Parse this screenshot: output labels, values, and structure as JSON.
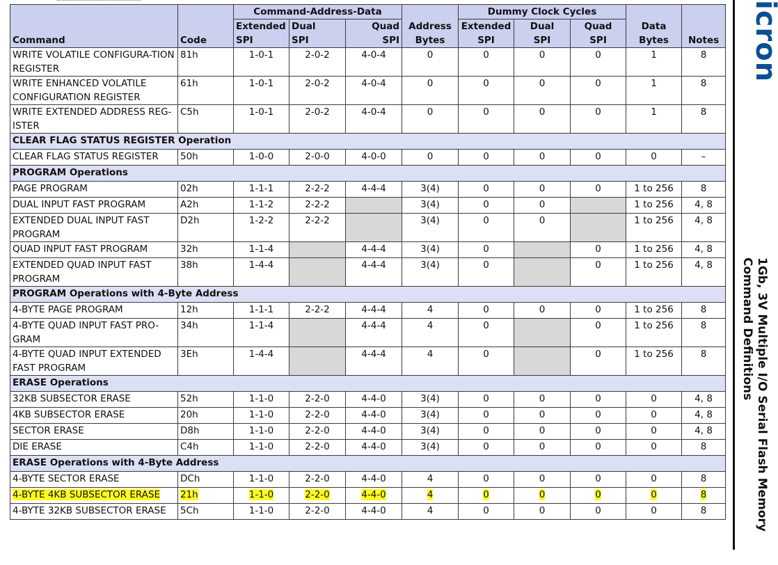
{
  "brand": {
    "logo_text": "icron"
  },
  "side_title": {
    "line1": "1Gb, 3V Multiple I/O Serial Flash Memory",
    "line2": "Command Definitions"
  },
  "header": {
    "group_cad": "Command-Address-Data",
    "group_dummy": "Dummy Clock Cycles",
    "command": "Command",
    "code": "Code",
    "ext_spi": [
      "Extended",
      "SPI"
    ],
    "dual_spi": [
      "Dual",
      "SPI"
    ],
    "quad_spi": [
      "Quad",
      "SPI"
    ],
    "address_bytes": [
      "Address",
      "Bytes"
    ],
    "dummy_ext": [
      "Extended",
      "SPI"
    ],
    "dummy_dual": [
      "Dual",
      "SPI"
    ],
    "dummy_quad": [
      "Quad",
      "SPI"
    ],
    "data_bytes": [
      "Data",
      "Bytes"
    ],
    "notes": "Notes"
  },
  "rows": [
    {
      "cmd": "WRITE VOLATILE CONFIGURA-TION REGISTER",
      "code": "81h",
      "ext": "1-0-1",
      "dual": "2-0-2",
      "quad": "4-0-4",
      "addr": "0",
      "d_ext": "0",
      "d_dual": "0",
      "d_quad": "0",
      "data": "1",
      "notes": "8"
    },
    {
      "cmd": "WRITE ENHANCED VOLATILE CONFIGURATION REGISTER",
      "code": "61h",
      "ext": "1-0-1",
      "dual": "2-0-2",
      "quad": "4-0-4",
      "addr": "0",
      "d_ext": "0",
      "d_dual": "0",
      "d_quad": "0",
      "data": "1",
      "notes": "8"
    },
    {
      "cmd": "WRITE EXTENDED ADDRESS REG-ISTER",
      "code": "C5h",
      "ext": "1-0-1",
      "dual": "2-0-2",
      "quad": "4-0-4",
      "addr": "0",
      "d_ext": "0",
      "d_dual": "0",
      "d_quad": "0",
      "data": "1",
      "notes": "8"
    },
    {
      "section": "CLEAR FLAG STATUS REGISTER Operation"
    },
    {
      "cmd": "CLEAR FLAG STATUS REGISTER",
      "code": "50h",
      "ext": "1-0-0",
      "dual": "2-0-0",
      "quad": "4-0-0",
      "addr": "0",
      "d_ext": "0",
      "d_dual": "0",
      "d_quad": "0",
      "data": "0",
      "notes": "–"
    },
    {
      "section": "PROGRAM Operations"
    },
    {
      "cmd": "PAGE PROGRAM",
      "code": "02h",
      "ext": "1-1-1",
      "dual": "2-2-2",
      "quad": "4-4-4",
      "addr": "3(4)",
      "d_ext": "0",
      "d_dual": "0",
      "d_quad": "0",
      "data": "1 to 256",
      "notes": "8"
    },
    {
      "cmd": "DUAL INPUT FAST PROGRAM",
      "code": "A2h",
      "ext": "1-1-2",
      "dual": "2-2-2",
      "quad": "",
      "addr": "3(4)",
      "d_ext": "0",
      "d_dual": "0",
      "d_quad": "",
      "data": "1 to 256",
      "notes": "4, 8",
      "gray": [
        "quad",
        "d_quad"
      ]
    },
    {
      "cmd": "EXTENDED DUAL INPUT FAST PROGRAM",
      "code": "D2h",
      "ext": "1-2-2",
      "dual": "2-2-2",
      "quad": "",
      "addr": "3(4)",
      "d_ext": "0",
      "d_dual": "0",
      "d_quad": "",
      "data": "1 to 256",
      "notes": "4, 8",
      "gray": [
        "quad",
        "d_quad"
      ]
    },
    {
      "cmd": "QUAD INPUT FAST PROGRAM",
      "code": "32h",
      "ext": "1-1-4",
      "dual": "",
      "quad": "4-4-4",
      "addr": "3(4)",
      "d_ext": "0",
      "d_dual": "",
      "d_quad": "0",
      "data": "1 to 256",
      "notes": "4, 8",
      "gray": [
        "dual",
        "d_dual"
      ]
    },
    {
      "cmd": "EXTENDED QUAD INPUT FAST PROGRAM",
      "code": "38h",
      "ext": "1-4-4",
      "dual": "",
      "quad": "4-4-4",
      "addr": "3(4)",
      "d_ext": "0",
      "d_dual": "",
      "d_quad": "0",
      "data": "1 to 256",
      "notes": "4, 8",
      "gray": [
        "dual",
        "d_dual"
      ]
    },
    {
      "section": "PROGRAM Operations with 4-Byte Address"
    },
    {
      "cmd": "4-BYTE PAGE PROGRAM",
      "code": "12h",
      "ext": "1-1-1",
      "dual": "2-2-2",
      "quad": "4-4-4",
      "addr": "4",
      "d_ext": "0",
      "d_dual": "0",
      "d_quad": "0",
      "data": "1 to 256",
      "notes": "8"
    },
    {
      "cmd": "4-BYTE QUAD INPUT FAST PRO-GRAM",
      "code": "34h",
      "ext": "1-1-4",
      "dual": "",
      "quad": "4-4-4",
      "addr": "4",
      "d_ext": "0",
      "d_dual": "",
      "d_quad": "0",
      "data": "1 to 256",
      "notes": "8",
      "gray": [
        "dual",
        "d_dual"
      ]
    },
    {
      "cmd": "4-BYTE QUAD INPUT EXTENDED FAST PROGRAM",
      "code": "3Eh",
      "ext": "1-4-4",
      "dual": "",
      "quad": "4-4-4",
      "addr": "4",
      "d_ext": "0",
      "d_dual": "",
      "d_quad": "0",
      "data": "1 to 256",
      "notes": "8",
      "gray": [
        "dual",
        "d_dual"
      ]
    },
    {
      "section": "ERASE Operations"
    },
    {
      "cmd": "32KB SUBSECTOR ERASE",
      "code": "52h",
      "ext": "1-1-0",
      "dual": "2-2-0",
      "quad": "4-4-0",
      "addr": "3(4)",
      "d_ext": "0",
      "d_dual": "0",
      "d_quad": "0",
      "data": "0",
      "notes": "4, 8"
    },
    {
      "cmd": "4KB SUBSECTOR ERASE",
      "code": "20h",
      "ext": "1-1-0",
      "dual": "2-2-0",
      "quad": "4-4-0",
      "addr": "3(4)",
      "d_ext": "0",
      "d_dual": "0",
      "d_quad": "0",
      "data": "0",
      "notes": "4, 8"
    },
    {
      "cmd": "SECTOR ERASE",
      "code": "D8h",
      "ext": "1-1-0",
      "dual": "2-2-0",
      "quad": "4-4-0",
      "addr": "3(4)",
      "d_ext": "0",
      "d_dual": "0",
      "d_quad": "0",
      "data": "0",
      "notes": "4, 8"
    },
    {
      "cmd": "DIE ERASE",
      "code": "C4h",
      "ext": "1-1-0",
      "dual": "2-2-0",
      "quad": "4-4-0",
      "addr": "3(4)",
      "d_ext": "0",
      "d_dual": "0",
      "d_quad": "0",
      "data": "0",
      "notes": "8"
    },
    {
      "section": "ERASE Operations with 4-Byte Address"
    },
    {
      "cmd": "4-BYTE SECTOR ERASE",
      "code": "DCh",
      "ext": "1-1-0",
      "dual": "2-2-0",
      "quad": "4-4-0",
      "addr": "4",
      "d_ext": "0",
      "d_dual": "0",
      "d_quad": "0",
      "data": "0",
      "notes": "8"
    },
    {
      "cmd": "4-BYTE 4KB SUBSECTOR ERASE",
      "code": "21h",
      "ext": "1-1-0",
      "dual": "2-2-0",
      "quad": "4-4-0",
      "addr": "4",
      "d_ext": "0",
      "d_dual": "0",
      "d_quad": "0",
      "data": "0",
      "notes": "8",
      "highlight": true
    },
    {
      "cmd": "4-BYTE 32KB SUBSECTOR ERASE",
      "code": "5Ch",
      "ext": "1-1-0",
      "dual": "2-2-0",
      "quad": "4-4-0",
      "addr": "4",
      "d_ext": "0",
      "d_dual": "0",
      "d_quad": "0",
      "data": "0",
      "notes": "8"
    }
  ]
}
